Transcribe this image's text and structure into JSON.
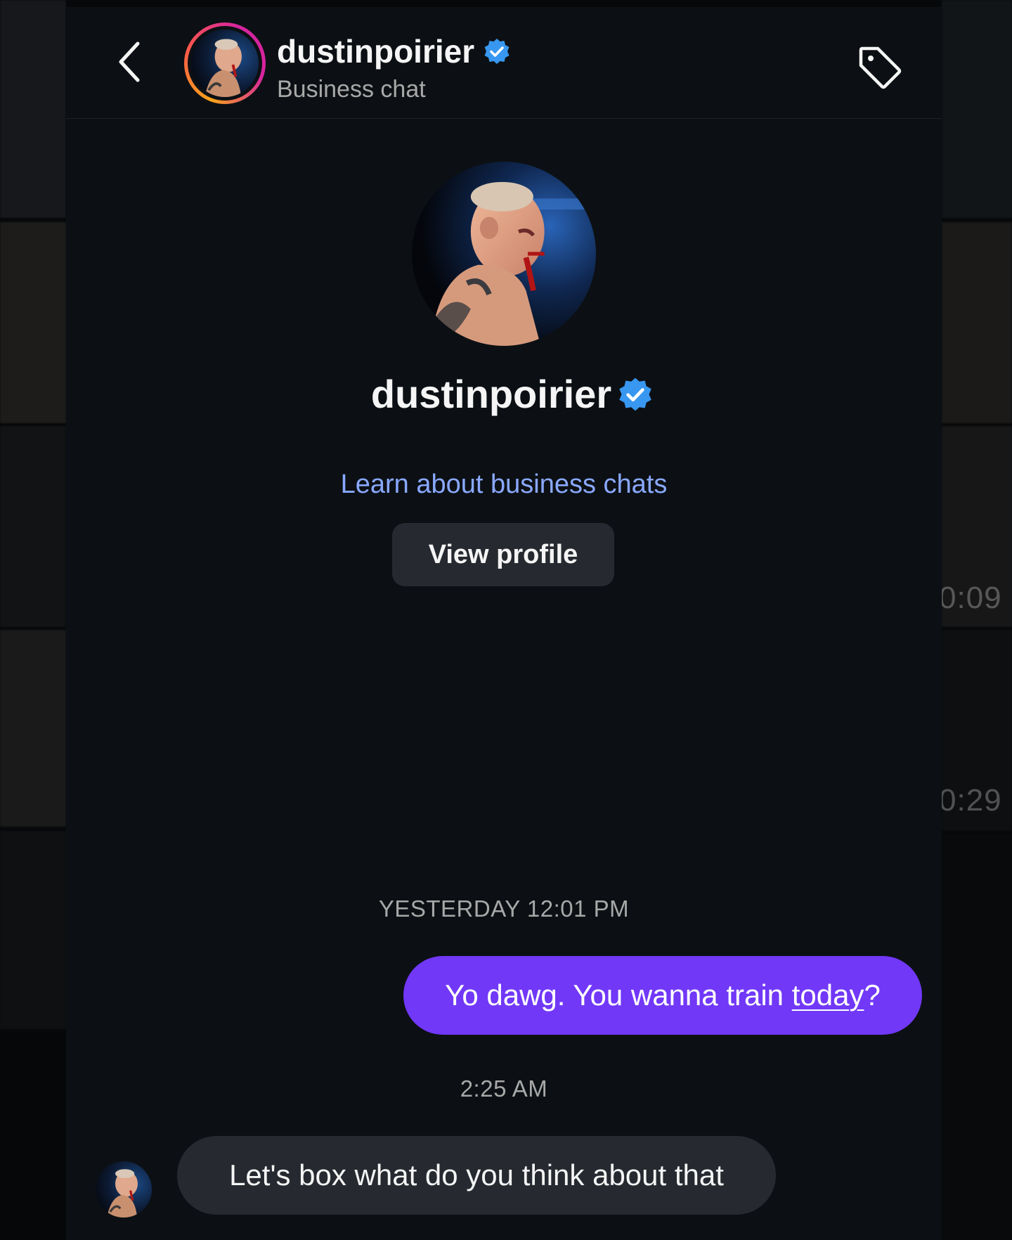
{
  "header": {
    "username": "dustinpoirier",
    "subtitle": "Business chat"
  },
  "profile": {
    "username": "dustinpoirier",
    "learn_link": "Learn about business chats",
    "view_profile_label": "View profile"
  },
  "messages": [
    {
      "timestamp": "YESTERDAY 12:01 PM",
      "direction": "outgoing",
      "text_before": "Yo dawg. You wanna train ",
      "text_link": "today",
      "text_after": "?"
    },
    {
      "timestamp": "2:25 AM",
      "direction": "incoming",
      "text": "Let's box what do you think about that"
    }
  ],
  "background_ghost": {
    "top_time": "0:09",
    "bottom_time": "0:29"
  },
  "icons": {
    "back": "chevron-left-icon",
    "tag": "tag-icon",
    "verified": "verified-badge-icon"
  },
  "colors": {
    "background": "#0c1014",
    "outgoing_bubble": "#7138f7",
    "incoming_bubble": "#262a30",
    "link": "#8aa8ff",
    "verified": "#3897f0"
  }
}
